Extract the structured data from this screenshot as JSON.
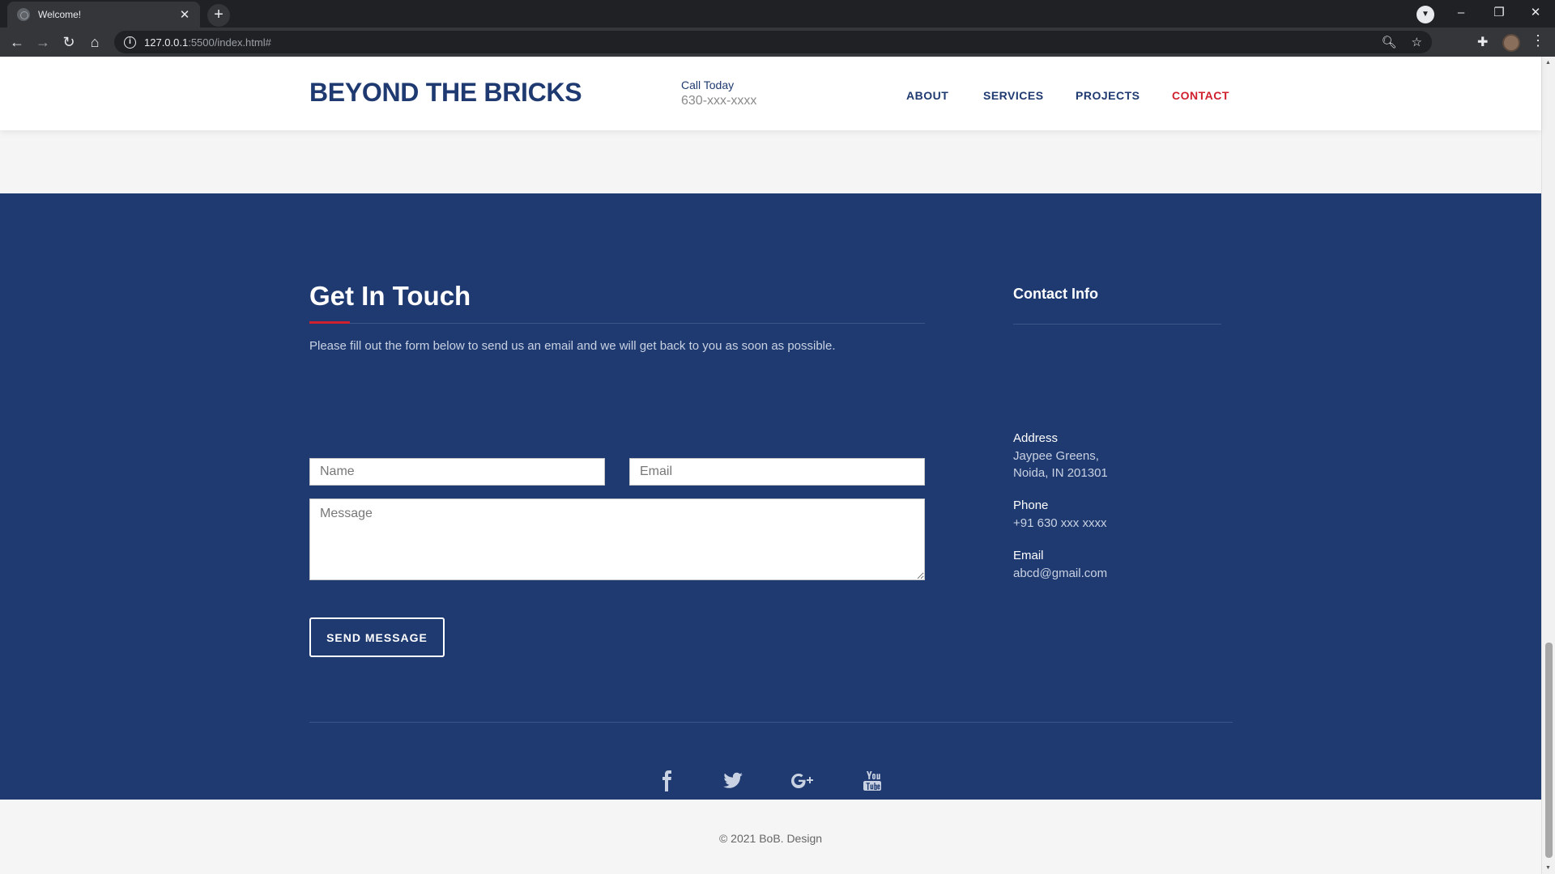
{
  "browser": {
    "tab_title": "Welcome!",
    "url_host": "127.0.0.1",
    "url_rest": ":5500/index.html#"
  },
  "header": {
    "brand": "BEYOND THE BRICKS",
    "call_label": "Call Today",
    "call_phone": "630-xxx-xxxx",
    "nav": {
      "about": "ABOUT",
      "services": "SERVICES",
      "projects": "PROJECTS",
      "contact": "CONTACT"
    },
    "active_color": "#d0202e"
  },
  "contact": {
    "title": "Get In Touch",
    "description": "Please fill out the form below to send us an email and we will get back to you as soon as possible.",
    "name_placeholder": "Name",
    "email_placeholder": "Email",
    "message_placeholder": "Message",
    "send_label": "SEND MESSAGE",
    "bg_color": "#1f3a70"
  },
  "contact_info": {
    "title": "Contact Info",
    "address_label": "Address",
    "address_line1": "Jaypee Greens,",
    "address_line2": "Noida, IN 201301",
    "phone_label": "Phone",
    "phone_value": "+91 630 xxx xxxx",
    "email_label": "Email",
    "email_value": "abcd@gmail.com"
  },
  "social": [
    "facebook-icon",
    "twitter-icon",
    "google-plus-icon",
    "youtube-icon"
  ],
  "footer": {
    "copyright": "© 2021 BoB. Design"
  }
}
